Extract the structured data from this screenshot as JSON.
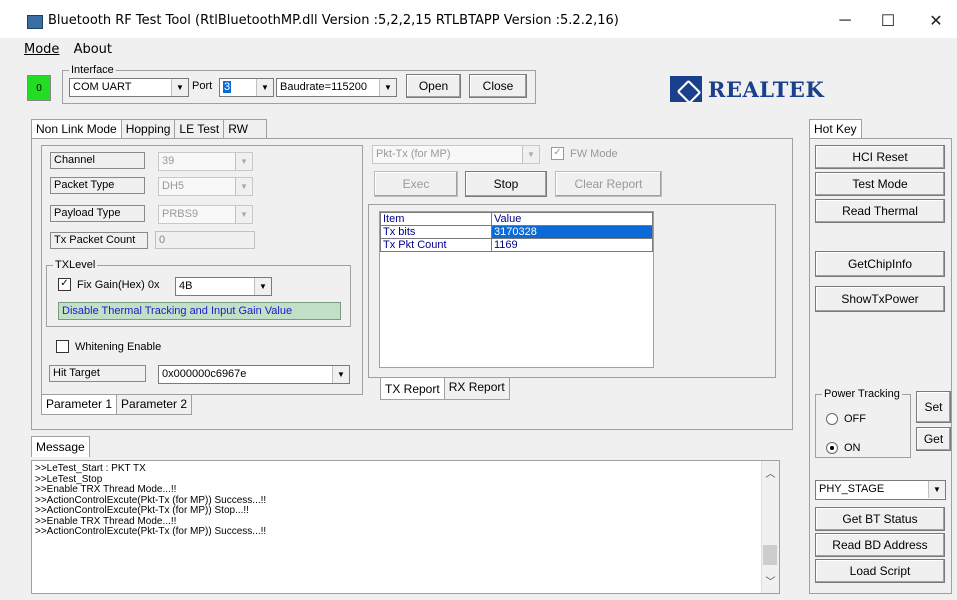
{
  "window": {
    "title": "Bluetooth RF Test Tool (RtlBluetoothMP.dll Version :5,2,2,15   RTLBTAPP Version :5.2.2,16)",
    "minimize": "─",
    "maximize": "☐",
    "close": "✕"
  },
  "menu": {
    "mode": "Mode",
    "about": "About"
  },
  "status_led": "0",
  "interface": {
    "legend": "Interface",
    "type_value": "COM UART",
    "port_label": "Port",
    "port_value": "3",
    "baudrate_value": "Baudrate=115200",
    "open_label": "Open",
    "close_label": "Close"
  },
  "logo": {
    "text": "REALTEK",
    "brand_color": "#1a3f8c"
  },
  "main_tabs": [
    "Non Link Mode",
    "Hopping",
    "LE Test",
    "RW"
  ],
  "params": {
    "channel_label": "Channel",
    "channel_value": "39",
    "packet_type_label": "Packet Type",
    "packet_type_value": "DH5",
    "payload_type_label": "Payload Type",
    "payload_type_value": "PRBS9",
    "tx_count_label": "Tx Packet Count",
    "tx_count_value": "0",
    "txlevel_legend": "TXLevel",
    "fix_gain_label": "Fix Gain(Hex)  0x",
    "fix_gain_value": "4B",
    "thermal_note": "Disable Thermal Tracking and Input Gain Value",
    "whitening_label": "Whitening Enable",
    "hit_target_label": "Hit Target",
    "hit_target_value": "0x000000c6967e",
    "tab1": "Parameter 1",
    "tab2": "Parameter 2"
  },
  "test": {
    "mode_value": "Pkt-Tx (for MP)",
    "fw_mode_label": "FW Mode",
    "exec_label": "Exec",
    "stop_label": "Stop",
    "clear_label": "Clear Report",
    "table_headers": [
      "Item",
      "Value"
    ],
    "rows": [
      {
        "item": "Tx bits",
        "value": "3170328"
      },
      {
        "item": "Tx Pkt Count",
        "value": "1169"
      }
    ],
    "tx_report_tab": "TX Report",
    "rx_report_tab": "RX Report"
  },
  "message": {
    "tab": "Message",
    "lines": [
      ">>LeTest_Start : PKT TX",
      ">>LeTest_Stop",
      ">>Enable TRX Thread Mode...!!",
      ">>ActionControlExcute(Pkt-Tx (for MP)) Success...!!",
      ">>ActionControlExcute(Pkt-Tx (for MP)) Stop...!!",
      ">>Enable TRX Thread Mode...!!",
      ">>ActionControlExcute(Pkt-Tx (for MP)) Success...!!"
    ]
  },
  "hotkey": {
    "tab": "Hot Key",
    "hci_reset": "HCI Reset",
    "test_mode": "Test Mode",
    "read_thermal": "Read Thermal",
    "get_chip_info": "GetChipInfo",
    "show_tx_power": "ShowTxPower",
    "power_tracking_legend": "Power Tracking",
    "off_label": "OFF",
    "on_label": "ON",
    "set_label": "Set",
    "get_label": "Get",
    "phy_stage_value": "PHY_STAGE",
    "get_bt_status": "Get BT Status",
    "read_bd_address": "Read BD Address",
    "load_script": "Load Script"
  }
}
